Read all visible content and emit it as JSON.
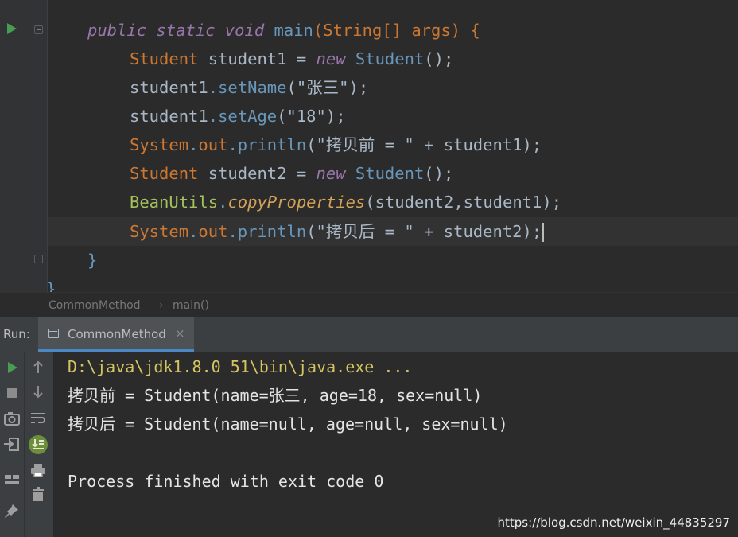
{
  "editor": {
    "line1": {
      "mods": "public static void",
      "name": "main",
      "open": "(",
      "type": "String",
      "arr": "[] ",
      "arg": "args",
      "close": ") {"
    },
    "line2": {
      "cls": "Student",
      "var": " student1 = ",
      "kw": "new",
      "sp": " ",
      "ctor": "Student",
      "end": "();"
    },
    "line3": {
      "obj": "student1",
      "dot": ".",
      "method": "setName",
      "open": "(",
      "str": "\"张三\"",
      "close": ");"
    },
    "line4": {
      "obj": "student1",
      "dot": ".",
      "method": "setAge",
      "open": "(",
      "str": "\"18\"",
      "close": ");"
    },
    "line5": {
      "cls": "System",
      "dot": ".",
      "field": "out",
      "dot2": ".",
      "method": "println",
      "open": "(",
      "str": "\"拷贝前 = \"",
      "rest": " + student1);"
    },
    "line6": {
      "cls": "Student",
      "var": " student2 = ",
      "kw": "new",
      "sp": " ",
      "ctor": "Student",
      "end": "();"
    },
    "line7": {
      "cls": "BeanUtils",
      "dot": ".",
      "method": "copyProperties",
      "args": "(student2,student1);"
    },
    "line8": {
      "cls": "System",
      "dot": ".",
      "field": "out",
      "dot2": ".",
      "method": "println",
      "open": "(",
      "str": "\"拷贝后 = \"",
      "rest": " + student2);"
    },
    "line9": "}",
    "line10": "}"
  },
  "breadcrumb": {
    "items": [
      "CommonMethod",
      "main()"
    ],
    "sep": "›"
  },
  "run_panel": {
    "label": "Run:",
    "tab_label": "CommonMethod",
    "close_glyph": "×"
  },
  "console": {
    "lines": [
      "D:\\java\\jdk1.8.0_51\\bin\\java.exe ...",
      "拷贝前 = Student(name=张三, age=18, sex=null)",
      "拷贝后 = Student(name=null, age=null, sex=null)",
      "",
      "Process finished with exit code 0"
    ]
  },
  "watermark": "https://blog.csdn.net/weixin_44835297",
  "tool_icons": {
    "left": [
      "run-icon",
      "stop-icon",
      "camera-icon",
      "login-icon",
      "layout-icon",
      "pin-icon"
    ],
    "right": [
      "arrow-up-icon",
      "arrow-down-icon",
      "soft-wrap-icon",
      "scroll-to-end-icon",
      "print-icon",
      "trash-icon"
    ]
  },
  "colors": {
    "keyword": "#cc7832",
    "string": "#6a8759",
    "method": "#9876aa",
    "run_green": "#499c54",
    "tab_underline": "#4a88c7"
  }
}
